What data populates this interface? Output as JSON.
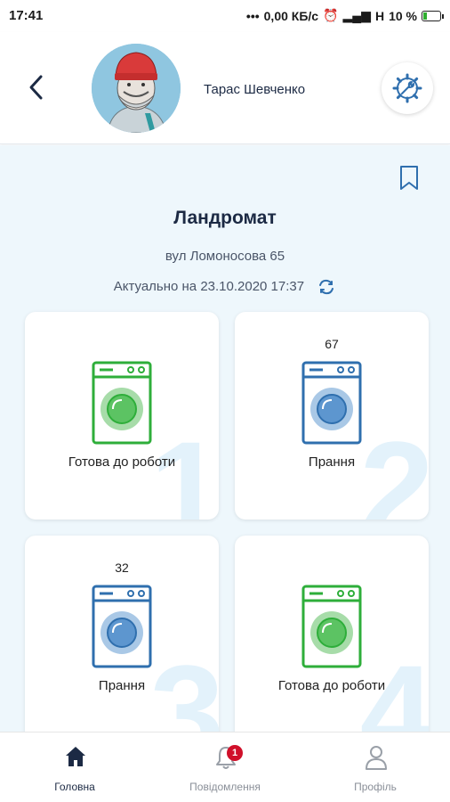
{
  "status_bar": {
    "time": "17:41",
    "network": "0,00 КБ/с",
    "signal": "Н",
    "battery": "10 %"
  },
  "header": {
    "user_name": "Тарас Шевченко"
  },
  "location": {
    "title": "Ландромат",
    "address": "вул Ломоносова 65",
    "updated": "Актуально на 23.10.2020 17:37"
  },
  "machines": [
    {
      "number": "1",
      "timer": "",
      "status": "Готова до роботи"
    },
    {
      "number": "2",
      "timer": "67",
      "status": "Прання"
    },
    {
      "number": "3",
      "timer": "32",
      "status": "Прання"
    },
    {
      "number": "4",
      "timer": "",
      "status": "Готова до роботи"
    }
  ],
  "nav": {
    "items": [
      {
        "label": "Головна",
        "icon": "home-icon"
      },
      {
        "label": "Повідомлення",
        "icon": "bell-icon",
        "badge": "1"
      },
      {
        "label": "Профіль",
        "icon": "user-icon"
      }
    ]
  },
  "colors": {
    "ready": "#2eae3a",
    "busy": "#2f6fae",
    "accent": "#1c2a44",
    "background": "#eef7fc"
  }
}
